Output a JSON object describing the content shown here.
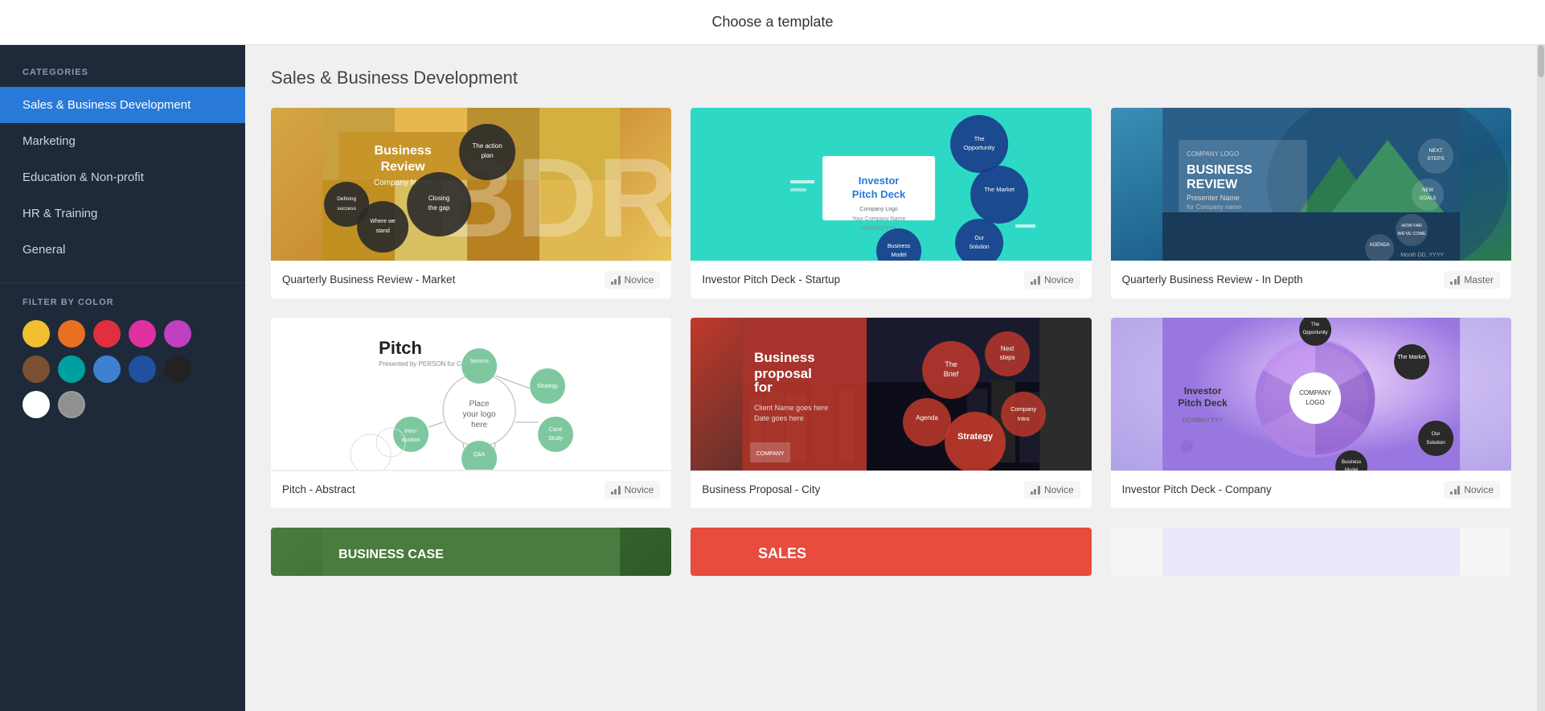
{
  "header": {
    "title": "Choose a template"
  },
  "sidebar": {
    "categories_label": "CATEGORIES",
    "items": [
      {
        "id": "sales",
        "label": "Sales & Business Development",
        "active": true
      },
      {
        "id": "marketing",
        "label": "Marketing",
        "active": false
      },
      {
        "id": "education",
        "label": "Education & Non-profit",
        "active": false
      },
      {
        "id": "hr",
        "label": "HR & Training",
        "active": false
      },
      {
        "id": "general",
        "label": "General",
        "active": false
      }
    ],
    "filter_label": "FILTER BY COLOR",
    "colors": [
      {
        "id": "yellow",
        "hex": "#f0c030"
      },
      {
        "id": "orange",
        "hex": "#e87020"
      },
      {
        "id": "red",
        "hex": "#e03040"
      },
      {
        "id": "pink",
        "hex": "#e030a0"
      },
      {
        "id": "purple",
        "hex": "#c040c0"
      },
      {
        "id": "brown",
        "hex": "#7a5030"
      },
      {
        "id": "teal",
        "hex": "#00a0a0"
      },
      {
        "id": "blue-medium",
        "hex": "#4080d0"
      },
      {
        "id": "blue-dark",
        "hex": "#2050a0"
      },
      {
        "id": "black",
        "hex": "#222222"
      },
      {
        "id": "white",
        "hex": "#ffffff"
      },
      {
        "id": "gray",
        "hex": "#909090"
      }
    ]
  },
  "content": {
    "section_title": "Sales & Business Development",
    "templates": [
      {
        "id": "qbr-market",
        "name": "Quarterly Business Review - Market",
        "level": "Novice",
        "thumb_type": "qbr-market"
      },
      {
        "id": "investor-startup",
        "name": "Investor Pitch Deck - Startup",
        "level": "Novice",
        "thumb_type": "investor-pitch"
      },
      {
        "id": "qbr-indepth",
        "name": "Quarterly Business Review - In Depth",
        "level": "Master",
        "thumb_type": "qbr-indepth"
      },
      {
        "id": "pitch-abstract",
        "name": "Pitch - Abstract",
        "level": "Novice",
        "thumb_type": "pitch-abstract"
      },
      {
        "id": "biz-proposal-city",
        "name": "Business Proposal - City",
        "level": "Novice",
        "thumb_type": "biz-proposal"
      },
      {
        "id": "investor-company",
        "name": "Investor Pitch Deck - Company",
        "level": "Novice",
        "thumb_type": "investor-company"
      }
    ],
    "partial_templates": [
      {
        "id": "biz-case",
        "thumb_type": "biz-case"
      },
      {
        "id": "sales",
        "thumb_type": "sales"
      },
      {
        "id": "extra",
        "thumb_type": "extra"
      }
    ]
  }
}
